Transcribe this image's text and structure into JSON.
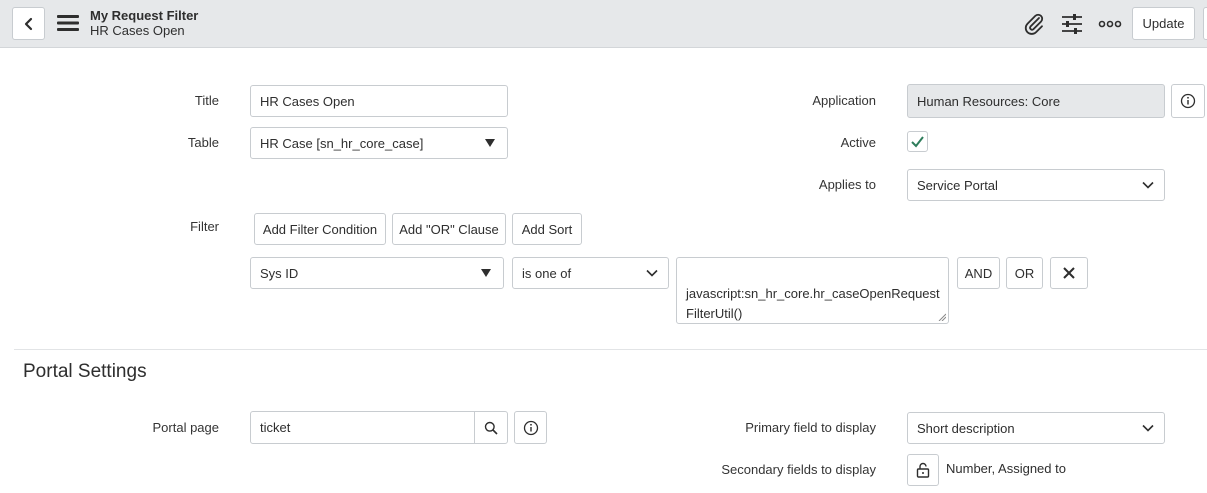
{
  "header": {
    "title": "My Request Filter",
    "subtitle": "HR Cases Open",
    "update_label": "Update",
    "icons": [
      "back-icon",
      "menu-icon",
      "attachment-icon",
      "sliders-icon",
      "more-icon"
    ]
  },
  "form": {
    "title_label": "Title",
    "title_value": "HR Cases Open",
    "table_label": "Table",
    "table_value": "HR Case [sn_hr_core_case]",
    "application_label": "Application",
    "application_value": "Human Resources: Core",
    "active_label": "Active",
    "active_checked": true,
    "applies_to_label": "Applies to",
    "applies_to_value": "Service Portal",
    "filter_label": "Filter",
    "add_filter_condition": "Add Filter Condition",
    "add_or_clause": "Add \"OR\" Clause",
    "add_sort": "Add Sort",
    "condition": {
      "field": "Sys ID",
      "operator": "is one of",
      "value": "javascript:sn_hr_core.hr_caseOpenRequest\nFilterUtil()",
      "and_label": "AND",
      "or_label": "OR"
    }
  },
  "portal_settings": {
    "section_title": "Portal Settings",
    "portal_page_label": "Portal page",
    "portal_page_value": "ticket",
    "primary_field_label": "Primary field to display",
    "primary_field_value": "Short description",
    "secondary_fields_label": "Secondary fields to display",
    "secondary_fields_value": "Number, Assigned to"
  },
  "colors": {
    "header_bg": "#e6e8ea",
    "checkmark": "#2e7d5b",
    "border": "#c8ccd0"
  }
}
